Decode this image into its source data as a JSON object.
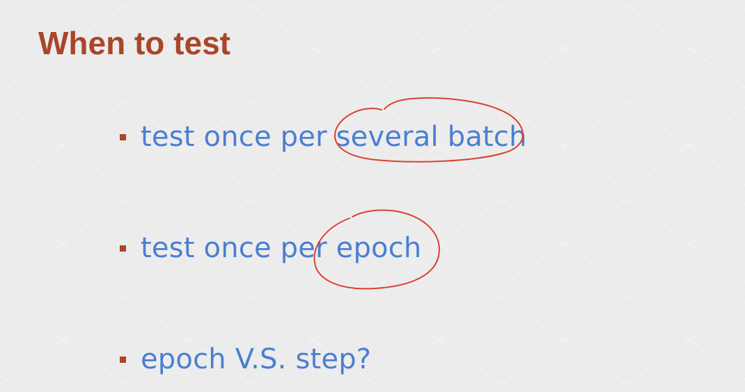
{
  "slide": {
    "title": "When to test",
    "bullets": [
      {
        "text": "test once per several batch"
      },
      {
        "text": "test once per epoch"
      },
      {
        "text": "epoch V.S. step?"
      }
    ]
  },
  "colors": {
    "title": "#a9462a",
    "bullet_text": "#4a7fd1",
    "bullet_marker": "#a9462a",
    "annotation": "#d9412f",
    "background": "#ececec"
  },
  "icons": {
    "bullet": "square-bullet-icon",
    "annotation": "hand-drawn-circle-icon"
  }
}
